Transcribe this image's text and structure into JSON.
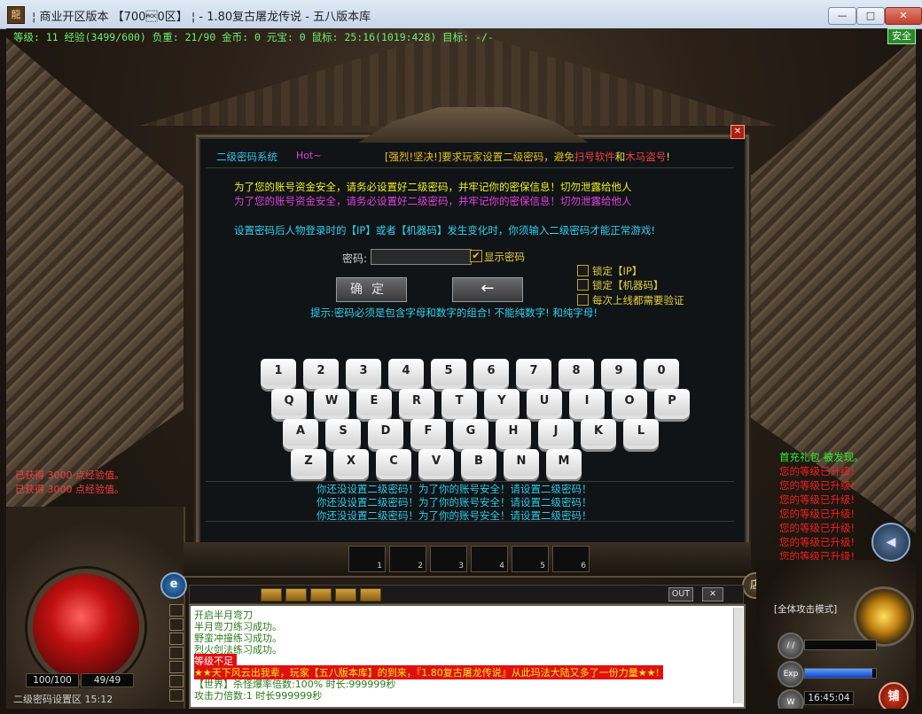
{
  "window": {
    "icon": "龍",
    "title": "¦ 商业开区版本 【700\u00060区】 ¦ - 1.80复古屠龙传说 - 五八版本库",
    "min": "—",
    "max": "□",
    "close": "✕"
  },
  "status": {
    "line": "等级: 11 经验(3499/600) 负重: 21/90 金币: 0 元宝: 0 鼠标: 25:16(1019:428) 目标: -/-",
    "safe": "安全"
  },
  "dialog": {
    "close": "✕",
    "sys_title": "二级密码系统",
    "hot": "Hot~",
    "notice_prefix": "[强烈!坚决!]",
    "notice_text": "要求玩家设置二级密码，避免",
    "notice_red1": "扫号软件",
    "notice_mid": "和",
    "notice_red2": "木马盗号",
    "notice_end": "!",
    "warn_1": "为了您的账号资金安全，请务必设置好二级密码，并牢记你的密保信息！切勿泄露给他人",
    "warn_2": "为了您的账号资金安全，请务必设置好二级密码，并牢记你的密保信息！切勿泄露给他人",
    "info": "设置密码后人物登录时的【IP】或者【机器码】发生变化时，你须输入二级密码才能正常游戏!",
    "pwd_label": "密码:",
    "pwd_value": "",
    "show_pwd_check": "✔",
    "show_pwd": "显示密码",
    "confirm": "确定",
    "back": "←",
    "lock_ip": "锁定【IP】",
    "lock_mc": "锁定【机器码】",
    "lock_daily": "每次上线都需要验证",
    "hint": "提示:密码必须是包含字母和数字的组合! 不能纯数字! 和纯字母!",
    "keys_row1": [
      "1",
      "2",
      "3",
      "4",
      "5",
      "6",
      "7",
      "8",
      "9",
      "0"
    ],
    "keys_row2": [
      "Q",
      "W",
      "E",
      "R",
      "T",
      "Y",
      "U",
      "I",
      "O",
      "P"
    ],
    "keys_row3": [
      "A",
      "S",
      "D",
      "F",
      "G",
      "H",
      "J",
      "K",
      "L"
    ],
    "keys_row4": [
      "Z",
      "X",
      "C",
      "V",
      "B",
      "N",
      "M"
    ]
  },
  "scroll_msgs": [
    "你还没设置二级密码！为了你的账号安全！请设置二级密码！",
    "你还没设置二级密码！为了你的账号安全！请设置二级密码！",
    "你还没设置二级密码！为了你的账号安全！请设置二级密码！"
  ],
  "exp_msgs": [
    "已获得 3000 点经验值。",
    "已获得 3000 点经验值。"
  ],
  "right_msgs": {
    "first": "首充礼包 被发现。",
    "levelup": "您的等级已升级!",
    "levelup_count": 9
  },
  "hud": {
    "hp": "100/100",
    "mp": "49/49",
    "map": "二级密码设置区 15:12",
    "e_btn": "e",
    "shop": "店",
    "slots": [
      "1",
      "2",
      "3",
      "4",
      "5",
      "6"
    ],
    "chat_out": "OUT",
    "chat_x": "✕",
    "pk_mode": "[全体攻击模式]",
    "bar1_label": "/ /",
    "bar2_label": "Exp",
    "bar3_label": "W",
    "clock": "16:45:04",
    "stall": "铺",
    "speaker": "◀"
  },
  "chat": [
    {
      "text": "开启半月弯刀",
      "color": "#2a7a1a"
    },
    {
      "text": "半月弯刀练习成功。",
      "color": "#2a7a1a"
    },
    {
      "text": "野蛮冲撞练习成功。",
      "color": "#2a7a1a"
    },
    {
      "text": "烈火剑法练习成功。",
      "color": "#2a7a1a"
    },
    {
      "text": "等级不足",
      "color": "#ffffff",
      "bg": "#e01010"
    },
    {
      "text": "★★天下风云出我辈，玩家【五八版本库】的到来，『1.80复古屠龙传说』从此玛法大陆又多了一份力量★★!",
      "color": "#f0f020",
      "bg": "#e01010"
    },
    {
      "text": "【世界】杀怪爆率倍数:100% 时长:999999秒",
      "color": "#2a7a1a"
    },
    {
      "text": "攻击力倍数:1 时长999999秒",
      "color": "#2a7a1a"
    }
  ],
  "colors": {
    "accent_cyan": "#30d0f0",
    "warn_yellow": "#f0f020",
    "warn_magenta": "#e040e0",
    "levelup_red": "#f02020",
    "levelup_green": "#30f030"
  }
}
